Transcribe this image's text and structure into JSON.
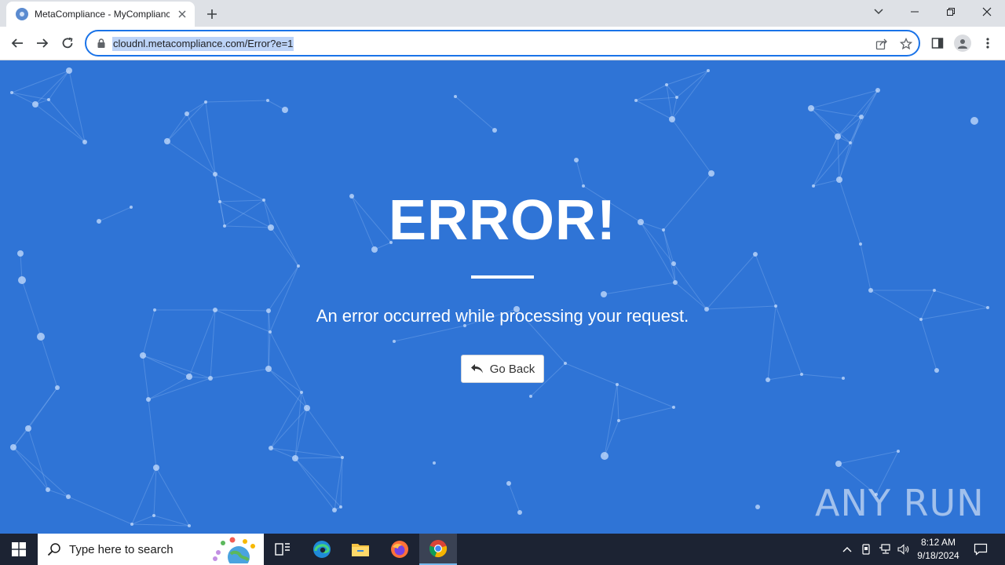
{
  "browser": {
    "tab": {
      "title": "MetaCompliance - MyCompliance",
      "favicon": "globe-icon"
    },
    "address": {
      "url": "cloudnl.metacompliance.com/Error?e=1"
    },
    "accent_color": "#1a73e8"
  },
  "page": {
    "heading": "ERROR!",
    "message": "An error occurred while processing your request.",
    "go_back_label": "Go Back",
    "background_color": "#2f74d6"
  },
  "watermark": {
    "text": "ANY RUN"
  },
  "taskbar": {
    "search_placeholder": "Type here to search",
    "clock": {
      "time": "8:12 AM",
      "date": "9/18/2024"
    },
    "apps": [
      "task-view-icon",
      "edge-icon",
      "file-explorer-icon",
      "firefox-icon",
      "chrome-icon"
    ]
  }
}
